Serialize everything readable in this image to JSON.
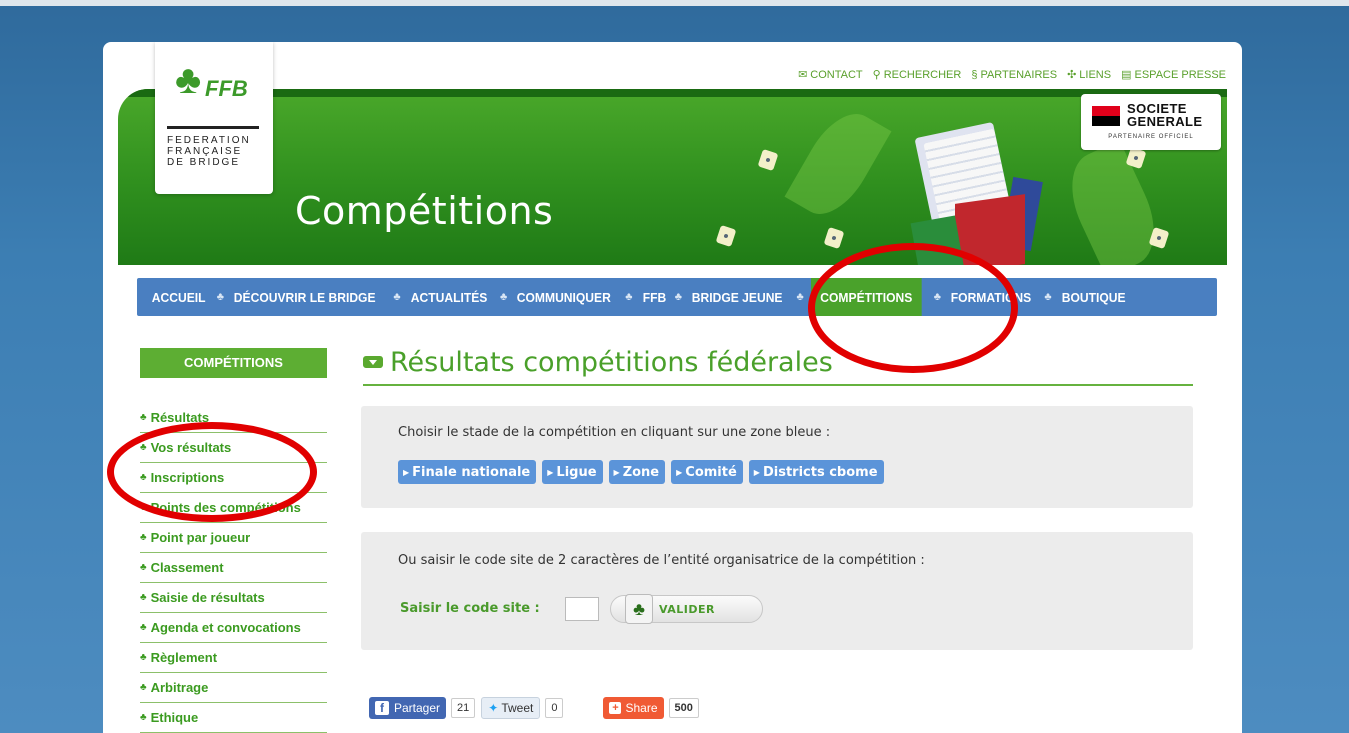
{
  "toplinks": {
    "contact": "CONTACT",
    "rechercher": "RECHERCHER",
    "partenaires": "PARTENAIRES",
    "liens": "LIENS",
    "espace_presse": "ESPACE PRESSE"
  },
  "logo": {
    "brand": "FFB",
    "federation_line1": "FEDERATION",
    "federation_line2": "FRANÇAISE",
    "federation_line3": "DE BRIDGE"
  },
  "banner": {
    "title": "Compétitions"
  },
  "sponsor": {
    "name_line1": "SOCIETE",
    "name_line2": "GENERALE",
    "subtitle": "PARTENAIRE OFFICIEL"
  },
  "nav": {
    "items": [
      {
        "label": "ACCUEIL"
      },
      {
        "label": "DÉCOUVRIR LE BRIDGE"
      },
      {
        "label": "ACTUALITÉS"
      },
      {
        "label": "COMMUNIQUER"
      },
      {
        "label": "FFB"
      },
      {
        "label": "BRIDGE JEUNE"
      },
      {
        "label": "COMPÉTITIONS"
      },
      {
        "label": "FORMATIONS"
      },
      {
        "label": "BOUTIQUE"
      }
    ],
    "active": "COMPÉTITIONS"
  },
  "sidebar": {
    "heading": "COMPÉTITIONS",
    "items": [
      {
        "label": "Résultats"
      },
      {
        "label": "Vos résultats"
      },
      {
        "label": "Inscriptions"
      },
      {
        "label": "Points des compétitions"
      },
      {
        "label": "Point par joueur"
      },
      {
        "label": "Classement"
      },
      {
        "label": "Saisie de résultats"
      },
      {
        "label": "Agenda et convocations"
      },
      {
        "label": "Règlement"
      },
      {
        "label": "Arbitrage"
      },
      {
        "label": "Ethique"
      }
    ]
  },
  "main": {
    "heading": "Résultats compétitions fédérales",
    "stage_prompt": "Choisir le stade de la compétition en cliquant sur une zone bleue :",
    "stages": [
      {
        "label": "Finale nationale"
      },
      {
        "label": "Ligue"
      },
      {
        "label": "Zone"
      },
      {
        "label": "Comité"
      },
      {
        "label": "Districts cbome"
      }
    ],
    "code_prompt": "Ou saisir le code site de 2 caractères de l’entité organisatrice de la compétition :",
    "code_label": "Saisir le code site :",
    "code_value": "",
    "validate_label": "VALIDER"
  },
  "social": {
    "facebook_label": "Partager",
    "facebook_count": "21",
    "tweet_label": "Tweet",
    "tweet_count": "0",
    "share_label": "Share",
    "share_count": "500"
  },
  "colors": {
    "accent_green": "#5dae33",
    "nav_blue": "#4a7fc1",
    "chip_blue": "#5b94d9",
    "annotation_red": "#e10000"
  }
}
